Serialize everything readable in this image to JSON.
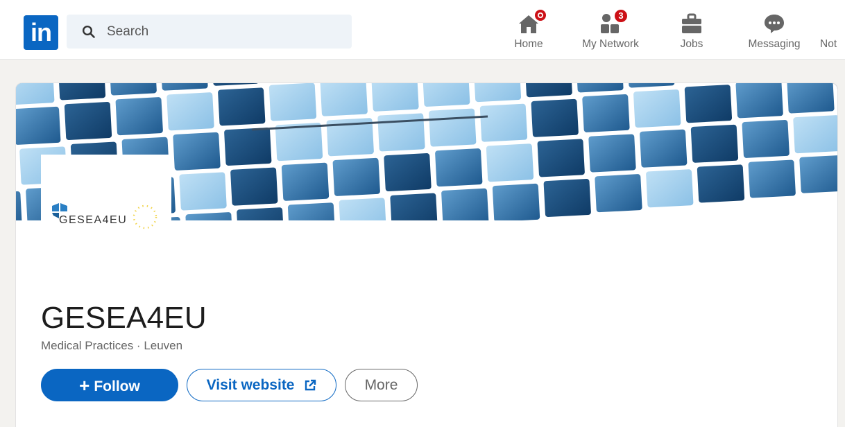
{
  "nav": {
    "logo_text": "in",
    "search_placeholder": "Search",
    "items": [
      {
        "label": "Home",
        "icon": "home-icon",
        "badge": ""
      },
      {
        "label": "My Network",
        "icon": "my-network-icon",
        "badge": "3"
      },
      {
        "label": "Jobs",
        "icon": "briefcase-icon",
        "badge": ""
      },
      {
        "label": "Messaging",
        "icon": "messaging-icon",
        "badge": ""
      },
      {
        "label": "Not",
        "icon": "notifications-icon",
        "badge": ""
      }
    ]
  },
  "company": {
    "name": "GESEA4EU",
    "subtitle": "Medical Practices · Leuven",
    "logo_text": "GESEA4EU"
  },
  "actions": {
    "follow_label": "Follow",
    "visit_label": "Visit website",
    "more_label": "More"
  },
  "colors": {
    "brand": "#0a66c2",
    "badge": "#cc1016",
    "cover_tile": "#2f6fa8"
  }
}
